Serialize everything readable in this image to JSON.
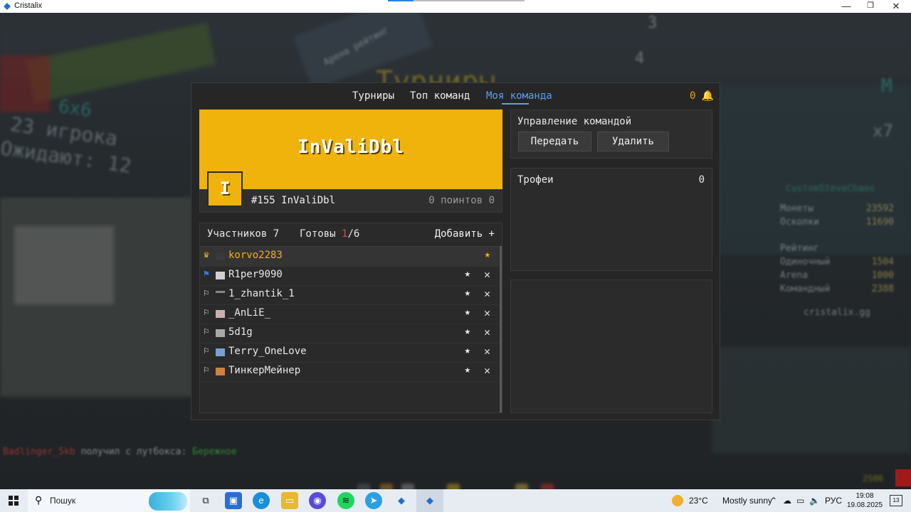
{
  "window": {
    "title": "Cristalix",
    "minimize": "—",
    "maximize": "❐",
    "close": "✕"
  },
  "background": {
    "arena_title": "Турниры",
    "left_mode": "6x6",
    "left_players": "23 игрока",
    "left_waiting": "Ожидают: 12",
    "top_sign": "Арена рейтинг",
    "rank_3": "3",
    "rank_4": "4",
    "right_head": "CustomSteveChaos",
    "right_corner": "M",
    "right_x7": "x7",
    "stats": [
      {
        "label": "Монеты",
        "value": "23592"
      },
      {
        "label": "Осколки",
        "value": "11690"
      },
      {
        "label": "Рейтинг",
        "value": ""
      },
      {
        "label": "Одиночный",
        "value": "1504"
      },
      {
        "label": "Arena",
        "value": "1000"
      },
      {
        "label": "Командный",
        "value": "2388"
      }
    ],
    "site": "cristalix.gg",
    "chat": {
      "player": "Badlinger_5kb",
      "text": "получил с лутбокса:",
      "item": "Бережное"
    },
    "corner_num": "2500"
  },
  "nav": {
    "tabs": [
      "Турниры",
      "Топ команд",
      "Моя команда"
    ],
    "active": "Моя команда",
    "notifications": "0 🔔"
  },
  "team": {
    "name": "InValiDbl",
    "badge_letter": "I",
    "rank_line": "#155 InValiDbl",
    "points_line": "0 поинтов 0",
    "banner_color": "#f0b30c"
  },
  "members": {
    "count_label": "Участников 7",
    "ready_label": "Готовы",
    "ready_done": "1",
    "ready_total": "/6",
    "add_label": "Добавить +",
    "list": [
      {
        "role": "♛",
        "name": "korvo2283",
        "leader": true
      },
      {
        "role": "⚑",
        "name": "R1per9090",
        "leader": false
      },
      {
        "role": "⚐",
        "name": "1_zhantik_1",
        "leader": false
      },
      {
        "role": "⚐",
        "name": "_AnLiE_",
        "leader": false
      },
      {
        "role": "⚐",
        "name": "5d1g",
        "leader": false
      },
      {
        "role": "⚐",
        "name": "Terry_OneLove",
        "leader": false
      },
      {
        "role": "⚐",
        "name": "ТинкерМейнер",
        "leader": false
      }
    ],
    "star": "★",
    "kick": "✕"
  },
  "management": {
    "title": "Управление командой",
    "transfer": "Передать",
    "delete": "Удалить"
  },
  "trophies": {
    "title": "Трофеи",
    "count": "0"
  },
  "taskbar": {
    "search_label": "Пошук",
    "search_icon": "search-icon",
    "temp": "23°C",
    "weather": "Mostly sunny",
    "lang": "РУС",
    "time": "19:08",
    "date": "19.08.2025",
    "notif_count": "13"
  }
}
